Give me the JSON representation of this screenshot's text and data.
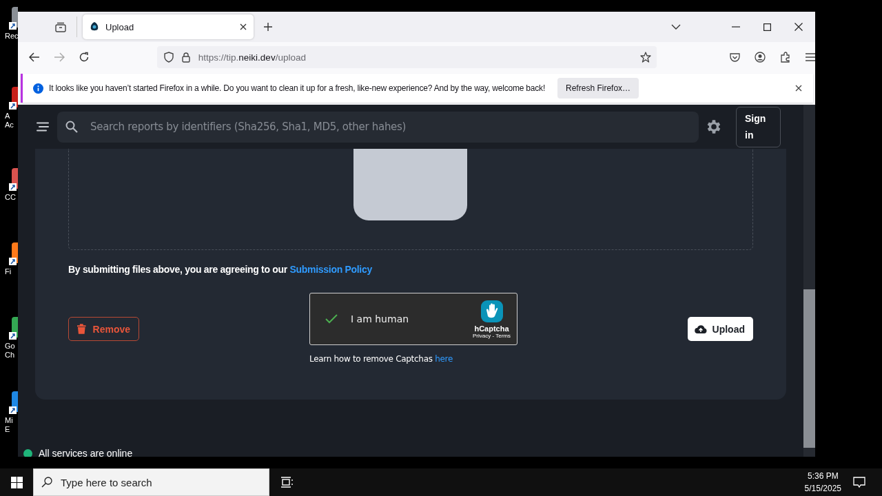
{
  "desktop": {
    "icons": [
      {
        "lines": [
          "Rec"
        ]
      },
      {
        "lines": [
          "A",
          "Ac"
        ]
      },
      {
        "lines": [
          "CC"
        ]
      },
      {
        "lines": [
          "Fi"
        ]
      },
      {
        "lines": [
          "Go",
          "Ch"
        ]
      },
      {
        "lines": [
          "Mi",
          "E"
        ]
      }
    ]
  },
  "browser": {
    "tabs": [
      {
        "title": "Upload",
        "selected": true
      }
    ],
    "nav": {
      "back_disabled": false,
      "forward_disabled": true
    },
    "url": {
      "host_prefix": "https://tip.",
      "host": "neiki.dev",
      "path": "/upload"
    },
    "notification": {
      "message": "It looks like you haven’t started Firefox in a while. Do you want to clean it up for a fresh, like-new experience? And by the way, welcome back!",
      "button": "Refresh Firefox…"
    }
  },
  "page": {
    "search": {
      "placeholder": "Search reports by identifiers (Sha256, Sha1, MD5, other hahes)"
    },
    "sign_in": "Sign in",
    "policy": {
      "text": "By submitting files above, you are agreeing to our",
      "link": "Submission Policy"
    },
    "remove_button": "Remove",
    "captcha": {
      "label": "I am human",
      "checked": true,
      "brand": "hCaptcha",
      "links": "Privacy - Terms"
    },
    "upload_button": "Upload",
    "captcha_note": {
      "text": "Learn how to remove Captchas",
      "link": "here"
    },
    "status": {
      "text": "All services are online",
      "color": "#1fb57a"
    }
  },
  "taskbar": {
    "search_placeholder": "Type here to search",
    "time": "5:36 PM",
    "date": "5/15/2025"
  }
}
